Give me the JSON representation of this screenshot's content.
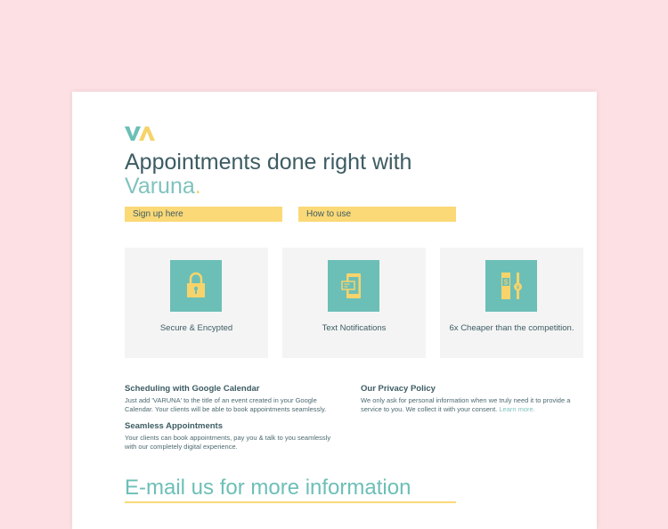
{
  "header": {
    "logo_text": "VA",
    "headline": "Appointments done right with",
    "brand": "Varuna",
    "brand_dot": "."
  },
  "buttons": {
    "signup": "Sign up here",
    "howto": "How to use"
  },
  "features": [
    {
      "icon": "lock-icon",
      "label": "Secure & Encypted"
    },
    {
      "icon": "phone-notification-icon",
      "label": "Text Notifications"
    },
    {
      "icon": "money-slider-icon",
      "label": "6x Cheaper than the competition."
    }
  ],
  "info": {
    "google": {
      "title": "Scheduling with Google Calendar",
      "body": "Just add 'VARUNA' to the title of an event created in your Google Calendar. Your clients will be able to book appointments seamlessly."
    },
    "seamless": {
      "title": "Seamless Appointments",
      "body": "Your clients can book appointments, pay you & talk to you seamlessly with our completely digital experience."
    },
    "privacy": {
      "title": "Our Privacy Policy",
      "body": "We only ask for personal information when we truly need it to provide a service to you. We collect it with your consent.",
      "link": "Learn more."
    }
  },
  "email_cta": "E-mail us for more information",
  "colors": {
    "background": "#fde0e3",
    "teal": "#6cbfb7",
    "yellow": "#fbd977",
    "text": "#3d5c63"
  }
}
